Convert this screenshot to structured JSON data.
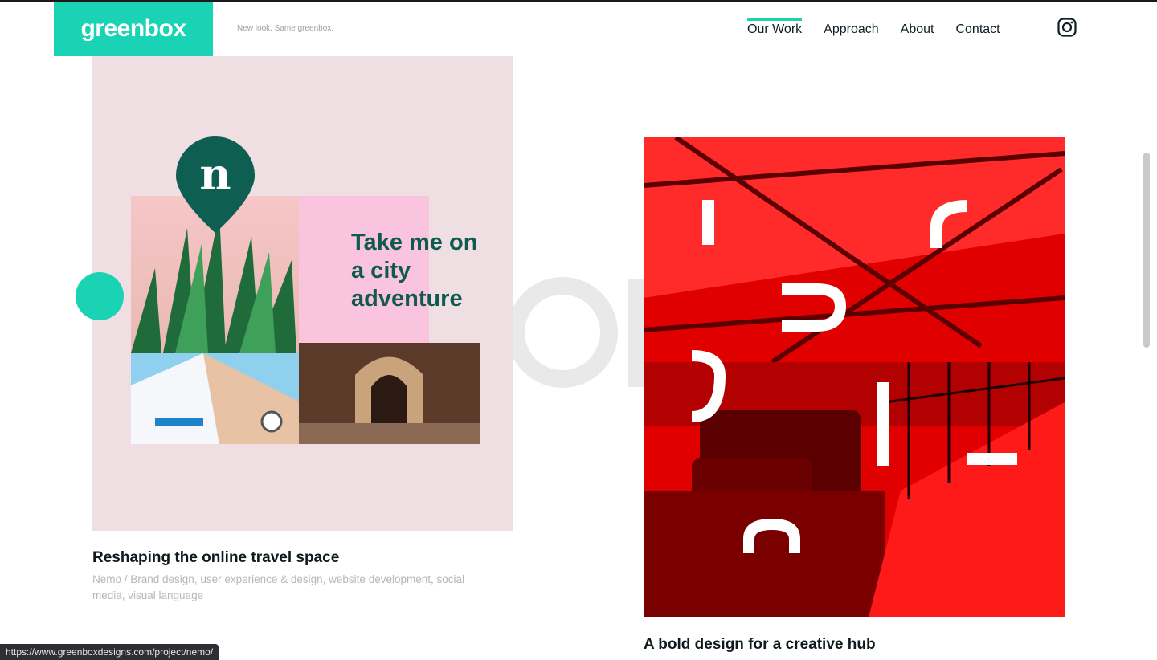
{
  "brand": {
    "logo_text": "greenbox",
    "tagline": "New look. Same greenbox.",
    "accent_color": "#1ad2b4"
  },
  "nav": {
    "items": [
      {
        "label": "Our Work",
        "active": true
      },
      {
        "label": "Approach",
        "active": false
      },
      {
        "label": "About",
        "active": false
      },
      {
        "label": "Contact",
        "active": false
      }
    ],
    "social_icon": "instagram-icon"
  },
  "projects": [
    {
      "title": "Reshaping the online travel space",
      "meta": "Nemo / Brand design, user experience & design, website development, social media, visual language",
      "image_text": "Take me on a city adventure",
      "pin_letter": "n",
      "bg_color": "#f0dfe2"
    },
    {
      "title": "A bold design for a creative hub",
      "bg_color": "#e30000"
    }
  ],
  "status_url": "https://www.greenboxdesigns.com/project/nemo/"
}
